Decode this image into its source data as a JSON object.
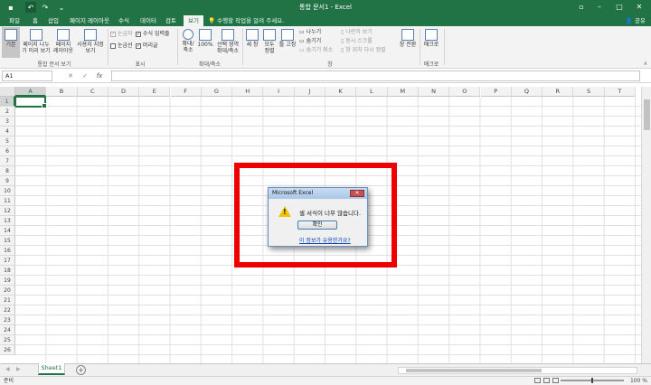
{
  "title_bar": {
    "title": "통합 문서1 - Excel",
    "icons": [
      "save-icon",
      "undo-icon",
      "redo-icon",
      "customize-icon"
    ],
    "window_buttons": [
      "ribbon-display-icon",
      "minimize-icon",
      "maximize-icon",
      "close-icon"
    ]
  },
  "tabs": [
    {
      "label": "파일"
    },
    {
      "label": "홈"
    },
    {
      "label": "삽입"
    },
    {
      "label": "페이지 레이아웃"
    },
    {
      "label": "수식"
    },
    {
      "label": "데이터"
    },
    {
      "label": "검토"
    },
    {
      "label": "보기",
      "active": true
    }
  ],
  "tell_me": "수행할 작업을 알려 주세요.",
  "share": "공유",
  "ribbon": {
    "workbook_views": {
      "label": "통합 문서 보기",
      "buttons": [
        {
          "line1": "기본",
          "line2": ""
        },
        {
          "line1": "페이지 나누",
          "line2": "기 미리 보기"
        },
        {
          "line1": "페이지",
          "line2": "레이아웃"
        },
        {
          "line1": "사용자 지정",
          "line2": "보기"
        }
      ]
    },
    "show": {
      "label": "표시",
      "ruler": "눈금자",
      "gridlines": "눈금선",
      "formula_bar": "수식 입력줄",
      "headings": "머리글"
    },
    "zoom": {
      "label": "확대/축소",
      "zoom": {
        "line1": "확대/",
        "line2": "축소"
      },
      "hundred": {
        "line1": "100%",
        "line2": ""
      },
      "zoom_selection": {
        "line1": "선택 영역",
        "line2": "확대/축소"
      }
    },
    "window": {
      "label": "창",
      "new_window": "새 창",
      "arrange_all": {
        "line1": "모두",
        "line2": "정렬"
      },
      "freeze_panes": {
        "line1": "틀 고정",
        "line2": ""
      },
      "split": "나누기",
      "hide": "숨기기",
      "unhide": "숨기기 취소",
      "view_side_by_side": "나란히 보기",
      "sync_scroll": "동시 스크롤",
      "reset_position": "창 위치 다시 정렬",
      "switch_windows": {
        "line1": "창 전환",
        "line2": ""
      }
    },
    "macros": {
      "label": "매크로",
      "button": {
        "line1": "매크로",
        "line2": ""
      }
    }
  },
  "formula_bar": {
    "name_box": "A1",
    "cancel": "✕",
    "enter": "✓",
    "fx": "fx",
    "value": ""
  },
  "grid": {
    "columns": [
      "A",
      "B",
      "C",
      "D",
      "E",
      "F",
      "G",
      "H",
      "I",
      "J",
      "K",
      "L",
      "M",
      "N",
      "O",
      "P",
      "Q",
      "R",
      "S",
      "T"
    ],
    "rows": [
      "1",
      "2",
      "3",
      "4",
      "5",
      "6",
      "7",
      "8",
      "9",
      "10",
      "11",
      "12",
      "13",
      "14",
      "15",
      "16",
      "17",
      "18",
      "19",
      "20",
      "21",
      "22",
      "23",
      "24",
      "25",
      "26"
    ],
    "active_cell": "A1"
  },
  "sheets": [
    {
      "name": "Sheet1",
      "active": true
    }
  ],
  "status": {
    "ready": "준비",
    "zoom": "100 %"
  },
  "dialog": {
    "title": "Microsoft Excel",
    "message": "셀 서식이 너무 많습니다.",
    "ok": "확인",
    "link": "이 정보가 유용한가요?"
  },
  "colors": {
    "brand": "#217346",
    "highlight": "#ee0000",
    "warning": "#f2c200"
  }
}
